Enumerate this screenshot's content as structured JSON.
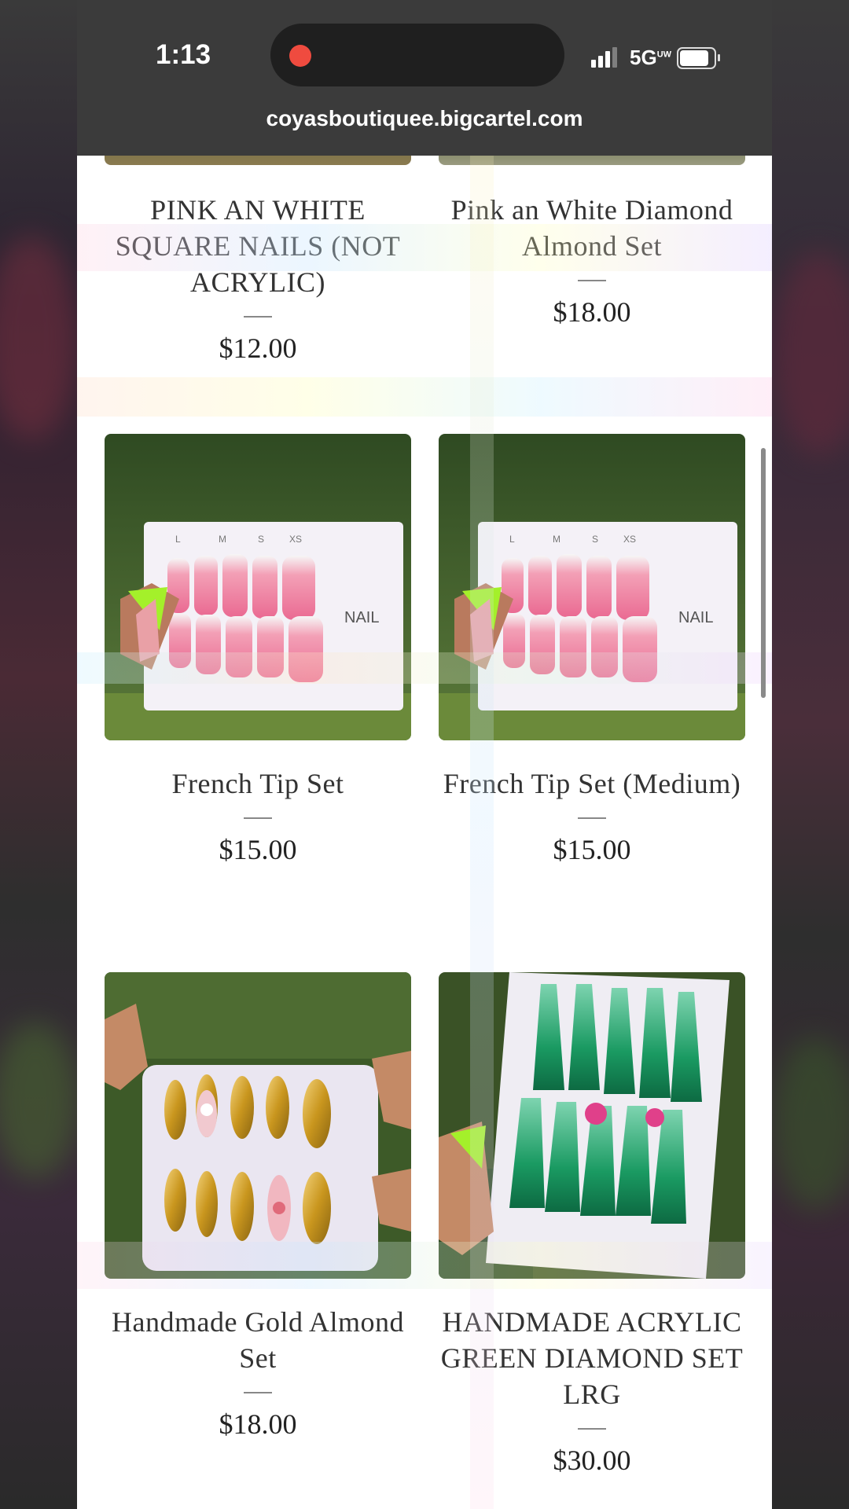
{
  "status": {
    "time": "1:13",
    "network": "5G",
    "network_sub": "UW"
  },
  "browser": {
    "url": "coyasboutiquee.bigcartel.com"
  },
  "products": [
    {
      "title": "PINK AN WHITE SQUARE NAILS (NOT ACRYLIC)",
      "price": "$12.00"
    },
    {
      "title": "Pink an White Diamond Almond Set",
      "price": "$18.00"
    },
    {
      "title": "French Tip Set",
      "price": "$15.00",
      "image": "pink-french-tip-nails-photo",
      "card_label": "NAIL",
      "sizes": [
        "L",
        "M",
        "S",
        "XS"
      ]
    },
    {
      "title": "French Tip Set (Medium)",
      "price": "$15.00",
      "image": "pink-french-tip-nails-photo",
      "card_label": "NAIL",
      "sizes": [
        "L",
        "M",
        "S",
        "XS"
      ]
    },
    {
      "title": "Handmade Gold Almond Set",
      "price": "$18.00",
      "image": "gold-almond-nails-photo"
    },
    {
      "title": "HANDMADE ACRYLIC GREEN DIAMOND SET LRG",
      "price": "$30.00",
      "image": "green-diamond-nails-photo"
    }
  ]
}
